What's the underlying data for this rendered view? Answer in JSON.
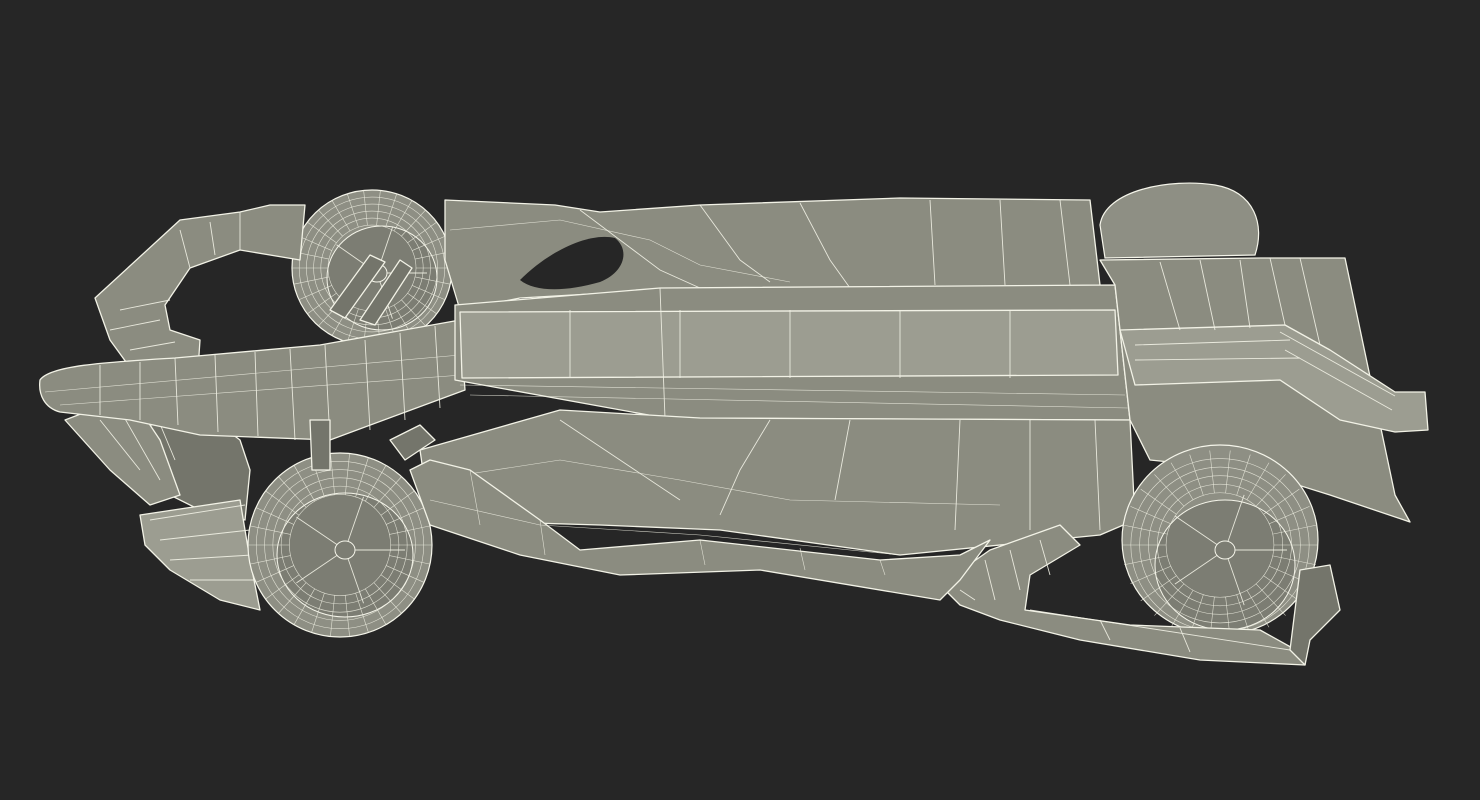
{
  "scene": {
    "subject": "",
    "background_color": "#262626",
    "model_fill_color": "#8b8c80",
    "wire_color": "#f2f2e6"
  }
}
